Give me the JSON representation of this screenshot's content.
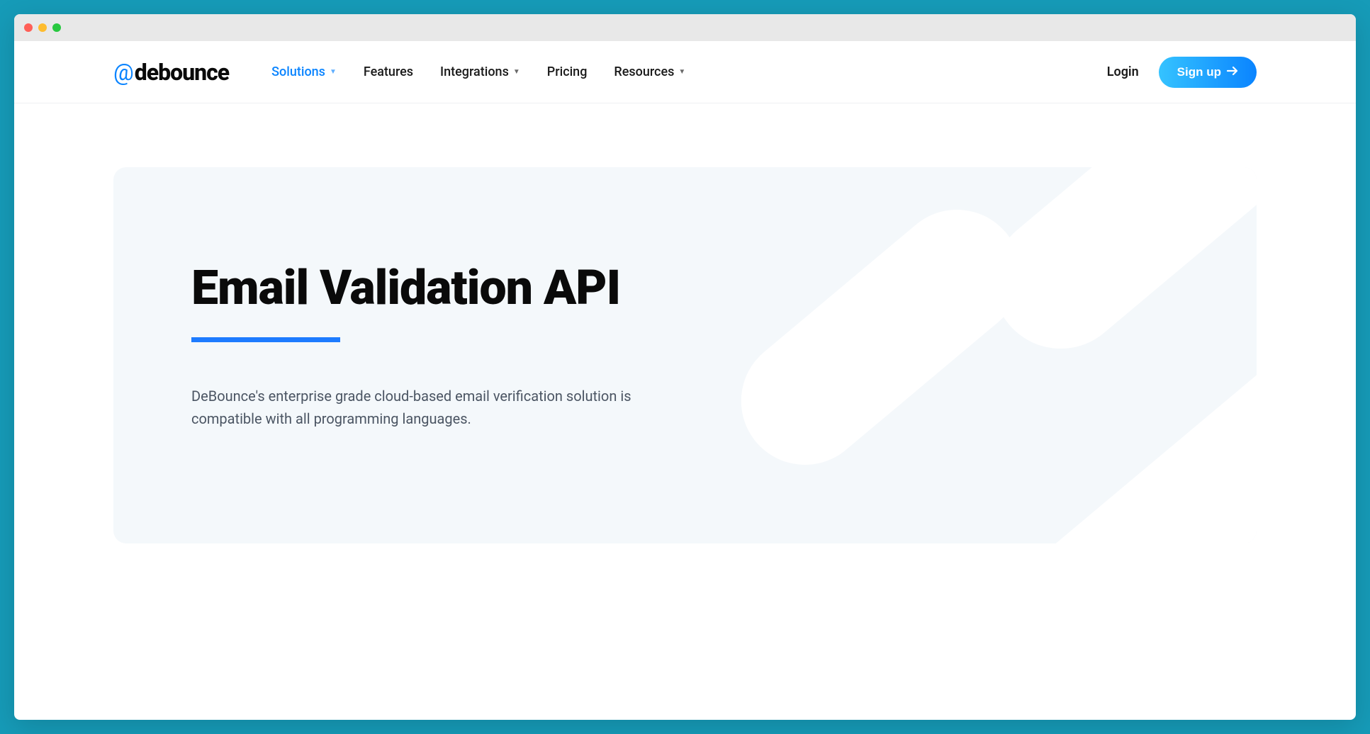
{
  "logo": {
    "at": "@",
    "text": "debounce"
  },
  "nav": {
    "solutions": "Solutions",
    "features": "Features",
    "integrations": "Integrations",
    "pricing": "Pricing",
    "resources": "Resources"
  },
  "auth": {
    "login": "Login",
    "signup": "Sign up"
  },
  "hero": {
    "title": "Email Validation API",
    "description": "DeBounce's enterprise grade cloud-based email verification solution is compatible with all programming languages."
  }
}
